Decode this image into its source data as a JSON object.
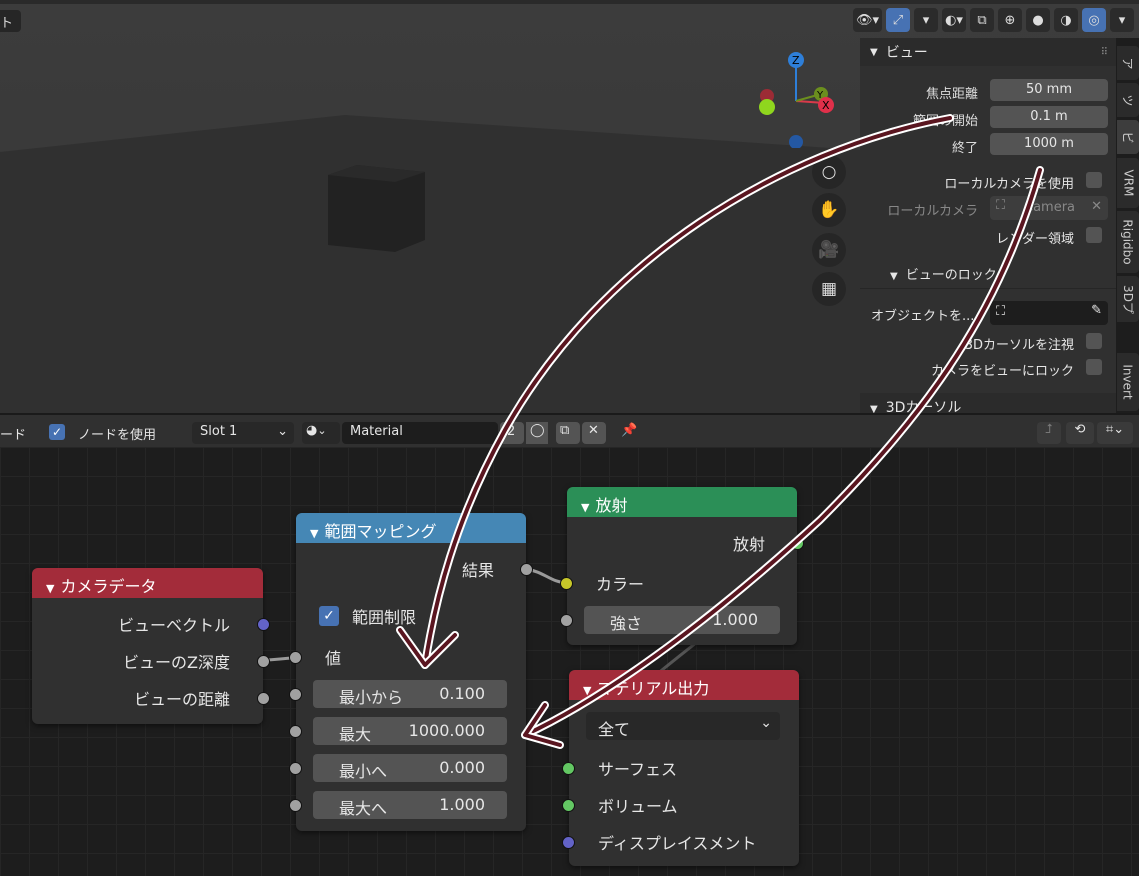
{
  "viewport": {
    "label": "ト",
    "tools": [
      "👁▾",
      "⤢",
      "▾",
      "◐▾",
      "⧉",
      "⊕",
      "●",
      "◑",
      "◎",
      "▾"
    ]
  },
  "npanel": {
    "section_title": "ビュー",
    "focal_length_label": "焦点距離",
    "focal_length": "50 mm",
    "clip_start_label": "範囲の開始",
    "clip_start": "0.1 m",
    "clip_end_label": "終了",
    "clip_end": "1000 m",
    "local_camera_use_label": "ローカルカメラを使用",
    "local_camera_label": "ローカルカメラ",
    "local_camera_value": "Camera",
    "render_region_label": "レンダー領域",
    "view_lock_title": "ビューのロック",
    "lock_object_label": "オブジェクトを...",
    "lock_cursor_label": "3Dカーソルを注視",
    "lock_camera_label": "カメラをビューにロック",
    "cursor_section_title": "3Dカーソル"
  },
  "tabs": [
    "ア",
    "ツ",
    "ビ",
    "VRM",
    "Rigidbo",
    "3Dプ",
    "Invert"
  ],
  "node_header": {
    "left_label": "ード",
    "use_nodes_label": "ノードを使用",
    "slot": "Slot 1",
    "material_name": "Material",
    "user_count": "2"
  },
  "nodes": {
    "camera": {
      "title": "カメラデータ",
      "outputs": [
        "ビューベクトル",
        "ビューのZ深度",
        "ビューの距離"
      ]
    },
    "maprange": {
      "title": "範囲マッピング",
      "result_label": "結果",
      "clamp_label": "範囲制限",
      "value_label": "値",
      "fields": [
        {
          "label": "最小から",
          "value": "0.100"
        },
        {
          "label": "最大",
          "value": "1000.000"
        },
        {
          "label": "最小へ",
          "value": "0.000"
        },
        {
          "label": "最大へ",
          "value": "1.000"
        }
      ]
    },
    "emission": {
      "title": "放射",
      "output_label": "放射",
      "color_label": "カラー",
      "strength_label": "強さ",
      "strength_value": "1.000"
    },
    "output": {
      "title": "マテリアル出力",
      "target": "全て",
      "inputs": [
        "サーフェス",
        "ボリューム",
        "ディスプレイスメント"
      ]
    }
  },
  "colors": {
    "camera_header": "#a32c3a",
    "maprange_header": "#4587b5",
    "emission_header": "#2b8f57",
    "output_header": "#a32c3a",
    "annotation_arrow": "#5a1620"
  }
}
